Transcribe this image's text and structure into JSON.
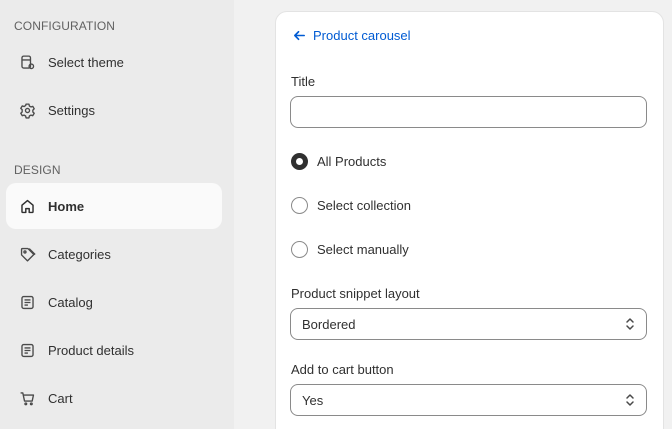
{
  "sidebar": {
    "configuration_heading": "CONFIGURATION",
    "design_heading": "DESIGN",
    "config_items": [
      {
        "label": "Select theme",
        "icon": "theme-icon"
      },
      {
        "label": "Settings",
        "icon": "gear-icon"
      }
    ],
    "design_items": [
      {
        "label": "Home",
        "icon": "home-icon",
        "active": true
      },
      {
        "label": "Categories",
        "icon": "tag-icon",
        "active": false
      },
      {
        "label": "Catalog",
        "icon": "catalog-icon",
        "active": false
      },
      {
        "label": "Product details",
        "icon": "product-details-icon",
        "active": false
      },
      {
        "label": "Cart",
        "icon": "cart-icon",
        "active": false
      }
    ]
  },
  "panel": {
    "back_label": "Product carousel",
    "title_label": "Title",
    "title_value": "",
    "source_options": [
      {
        "label": "All Products",
        "checked": true
      },
      {
        "label": "Select collection",
        "checked": false
      },
      {
        "label": "Select manually",
        "checked": false
      }
    ],
    "layout_label": "Product snippet layout",
    "layout_value": "Bordered",
    "cart_button_label": "Add to cart button",
    "cart_button_value": "Yes"
  },
  "colors": {
    "accent_link": "#005bd3",
    "sidebar_bg": "#ebebeb",
    "active_item_bg": "#fafafa"
  }
}
